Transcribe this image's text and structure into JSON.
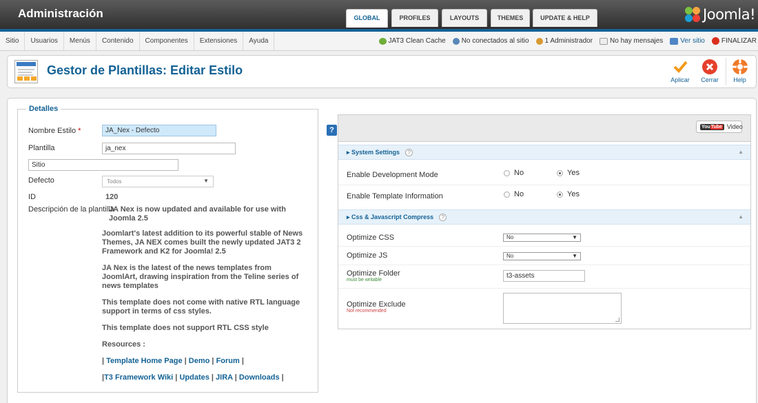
{
  "header": {
    "title": "Administración",
    "logo_text": "Joomla!"
  },
  "menu": [
    "Sitio",
    "Usuarios",
    "Menús",
    "Contenido",
    "Componentes",
    "Extensiones",
    "Ayuda"
  ],
  "status": {
    "clean_cache": "JAT3 Clean Cache",
    "connected": "No conectados al sitio",
    "admins": "1 Administrador",
    "messages": "No hay mensajes",
    "view_site": "Ver sitio",
    "logout": "FINALIZAR"
  },
  "toolbar": {
    "page_title": "Gestor de Plantillas: Editar Estilo",
    "apply": "Aplicar",
    "close": "Cerrar",
    "help": "Help"
  },
  "details": {
    "legend": "Detalles",
    "style_name_label": "Nombre Estilo",
    "style_name_required": "*",
    "style_name_value": "JA_Nex - Defecto",
    "template_label": "Plantilla",
    "template_value": "ja_nex",
    "client_value": "Sitio",
    "default_label": "Defecto",
    "default_value": "Todos",
    "id_label": "ID",
    "id_value": "120",
    "description_label": "Descripción de la plantilla",
    "description": [
      "JA Nex is now updated and available for use with Joomla 2.5",
      "Joomlart's latest addition to its powerful stable of News Themes, JA NEX comes built the newly updated JAT3 2 Framework and K2 for Joomla! 2.5",
      "JA Nex is the latest of the news templates from JoomlArt, drawing inspiration from the Teline series of news templates",
      "This template does not come with native RTL language support in terms of css styles.",
      "This template does not support RTL CSS style",
      "Resources :"
    ],
    "links_row1": {
      "sep": "| ",
      "a": "Template Home Page",
      "b": "Demo",
      "c": "Forum"
    },
    "links_row2": {
      "a": "T3 Framework Wiki",
      "b": "Updates",
      "c": "JIRA",
      "d": "Downloads"
    }
  },
  "panel": {
    "help": "?",
    "tabs": [
      "GLOBAL",
      "PROFILES",
      "LAYOUTS",
      "THEMES",
      "UPDATE & HELP"
    ],
    "video_logo_a": "You",
    "video_logo_b": "Tube",
    "video_label": "Video",
    "section1": "System Settings",
    "section2": "Css & Javascript Compress",
    "section_help": "?",
    "dev_mode_label": "Enable Development Mode",
    "template_info_label": "Enable Template Information",
    "radio_no": "No",
    "radio_yes": "Yes",
    "optimize_css_label": "Optimize CSS",
    "optimize_css_value": "No",
    "optimize_js_label": "Optimize JS",
    "optimize_js_value": "No",
    "optimize_folder_label": "Optimize Folder",
    "optimize_folder_note": "must be writable",
    "optimize_folder_value": "t3-assets",
    "optimize_exclude_label": "Optimize Exclude",
    "optimize_exclude_note": "Not recommended"
  },
  "colors": {
    "brand_blue": "#146295",
    "header_dark": "#2f2f2f",
    "highlight_input": "#cfe9fb"
  }
}
